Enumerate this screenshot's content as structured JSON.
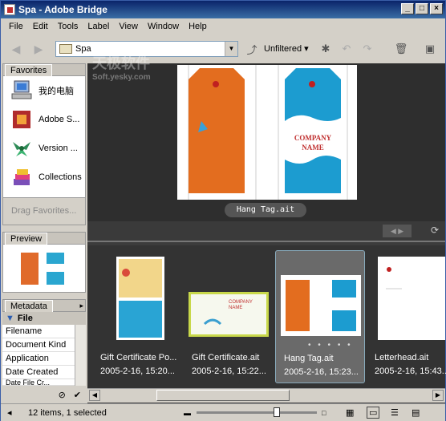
{
  "window": {
    "title": "Spa - Adobe Bridge",
    "min": "_",
    "max": "□",
    "close": "×"
  },
  "menu": [
    "File",
    "Edit",
    "Tools",
    "Label",
    "View",
    "Window",
    "Help"
  ],
  "toolbar": {
    "path": "Spa",
    "filter": "Unfiltered",
    "back": "◀",
    "forward": "▶",
    "dropdown": "▼"
  },
  "favorites": {
    "tab": "Favorites",
    "items": [
      {
        "label": "我的电脑",
        "icon": "computer-icon"
      },
      {
        "label": "Adobe S...",
        "icon": "adobe-stock-icon"
      },
      {
        "label": "Version ...",
        "icon": "version-cue-icon"
      },
      {
        "label": "Collections",
        "icon": "collections-icon"
      }
    ],
    "drag_hint": "Drag Favorites..."
  },
  "preview": {
    "tab": "Preview"
  },
  "metadata": {
    "tab": "Metadata",
    "section": "File",
    "fields": [
      "Filename",
      "Document Kind",
      "Application",
      "Date Created"
    ],
    "partial": "Date File Cr..."
  },
  "main_preview": {
    "caption": "Hang Tag.ait",
    "company_line1": "COMPANY",
    "company_line2": "NAME"
  },
  "thumbnails": [
    {
      "name": "Gift Certificate Po...",
      "date": "2005-2-16, 15:20..."
    },
    {
      "name": "Gift Certificate.ait",
      "date": "2005-2-16, 15:22..."
    },
    {
      "name": "Hang Tag.ait",
      "date": "2005-2-16, 15:23...",
      "selected": true
    },
    {
      "name": "Letterhead.ait",
      "date": "2005-2-16, 15:43..."
    }
  ],
  "thumb_company_line1": "COMPANY",
  "thumb_company_line2": "NAME",
  "status": {
    "text": "12 items, 1 selected"
  },
  "watermark": {
    "line1": "天极软件",
    "line2": "Soft.yesky.com"
  }
}
